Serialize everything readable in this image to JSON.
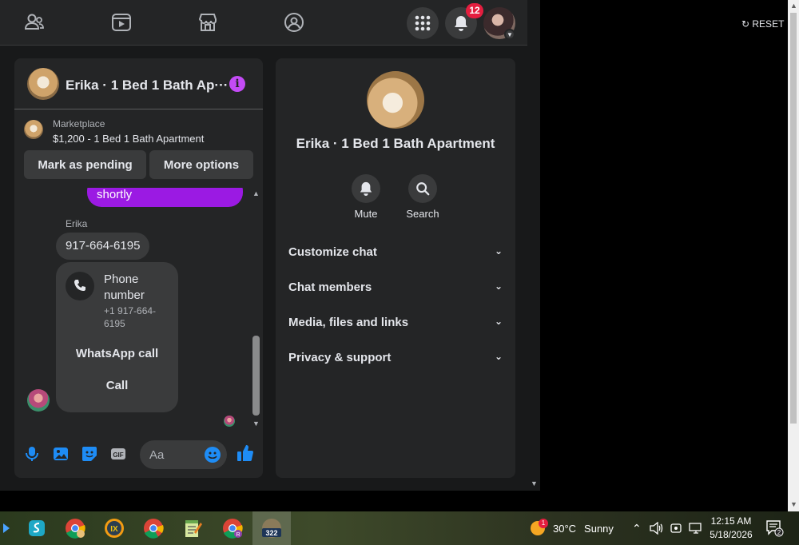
{
  "colors": {
    "bg": "#18191a",
    "surface": "#242526",
    "control": "#3a3b3c",
    "accent_purple": "#9b1ae3",
    "info_purple": "#c34bf5",
    "brand_blue": "#1e8cf5",
    "badge_red": "#e41e3f"
  },
  "topnav": {
    "icons": [
      "friends-icon",
      "watch-icon",
      "marketplace-icon",
      "groups-icon"
    ],
    "notifications_count": "12"
  },
  "chat": {
    "title": "Erika · 1 Bed 1 Bath Ap···",
    "marketplace_label": "Marketplace",
    "listing": "$1,200 - 1 Bed 1 Bath Apartment",
    "mark_pending": "Mark as pending",
    "more_options": "More options",
    "messages": {
      "outgoing_fragment": "shortly",
      "sender_name": "Erika",
      "phone_text": "917-664-6195",
      "card_title": "Phone number",
      "card_sub": "+1 917-664-6195",
      "whatsapp_call": "WhatsApp call",
      "call": "Call"
    },
    "composer": {
      "placeholder": "Aa",
      "gif_label": "GIF"
    }
  },
  "info_panel": {
    "title": "Erika · 1 Bed 1 Bath Apartment",
    "actions": [
      {
        "label": "Mute",
        "icon": "bell-icon"
      },
      {
        "label": "Search",
        "icon": "search-icon"
      }
    ],
    "sections": [
      "Customize chat",
      "Chat members",
      "Media, files and links",
      "Privacy & support"
    ]
  },
  "reset_label": "RESET",
  "taskbar": {
    "weather_temp": "30°C",
    "weather_text": "Sunny",
    "weather_badge": "1",
    "time": "12:15 AM",
    "date": "5/18/2026",
    "notif_count": "2",
    "app_badge": "322"
  }
}
